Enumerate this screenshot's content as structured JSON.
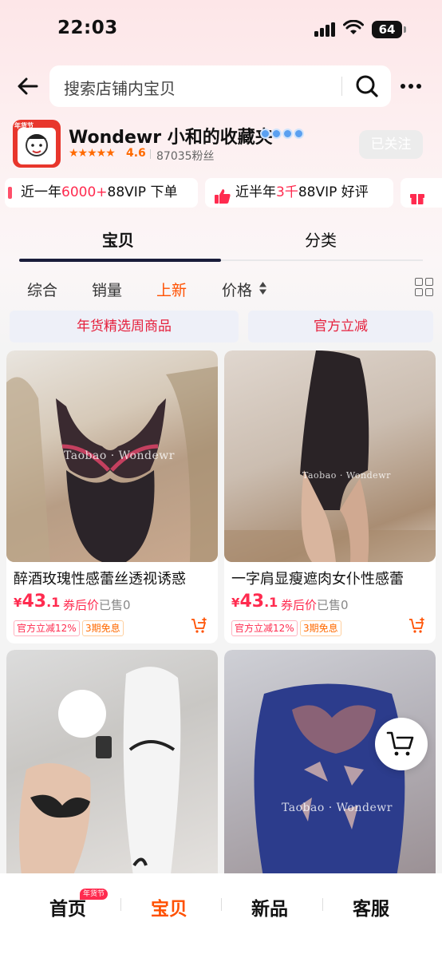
{
  "status_bar": {
    "time": "22:03",
    "battery": "64"
  },
  "search": {
    "placeholder": "搜索店铺内宝贝"
  },
  "shop": {
    "logo_tag": "年货节",
    "name": "Wondewr 小和的收藏夹",
    "stars": "★★★★★",
    "rating": "4.6",
    "fans": "87035粉丝",
    "follow_label": "已关注"
  },
  "perks": [
    {
      "pre": "近一年",
      "hl": "6000+",
      "post": "88VIP 下单"
    },
    {
      "pre": "近半年",
      "hl": "3千",
      "post": "88VIP 好评"
    }
  ],
  "tabs": [
    {
      "label": "宝贝",
      "active": true
    },
    {
      "label": "分类",
      "active": false
    }
  ],
  "sort": {
    "all": "综合",
    "sales": "销量",
    "new": "上新",
    "price": "价格"
  },
  "promos": [
    "年货精选周商品",
    "官方立减"
  ],
  "products": [
    {
      "title": "醉酒玫瑰性感蕾丝透视诱惑",
      "currency": "¥",
      "price_int": "43",
      "price_dec": ".1",
      "after_coupon": "券后价",
      "sold": "已售0",
      "badge1": "官方立减12%",
      "badge2": "3期免息",
      "watermark": "Taobao · Wondewr"
    },
    {
      "title": "一字肩显瘦遮肉女仆性感蕾",
      "currency": "¥",
      "price_int": "43",
      "price_dec": ".1",
      "after_coupon": "券后价",
      "sold": "已售0",
      "badge1": "官方立减12%",
      "badge2": "3期免息",
      "watermark": "Taobao · Wondewr"
    },
    {
      "watermark": ""
    },
    {
      "watermark": "Taobao · Wondewr"
    }
  ],
  "bottom_nav": {
    "home": "首页",
    "home_badge": "年货节",
    "goods": "宝贝",
    "new": "新品",
    "service": "客服"
  },
  "colors": {
    "accent": "#ff5000",
    "price": "#ff2b4f",
    "tab_indicator": "#1a1d3a"
  },
  "icons": [
    "back-arrow-icon",
    "search-icon",
    "more-icon",
    "signal-icon",
    "wifi-icon",
    "thumbs-up-icon",
    "gift-icon",
    "sort-arrows-icon",
    "grid-view-icon",
    "cart-icon"
  ]
}
